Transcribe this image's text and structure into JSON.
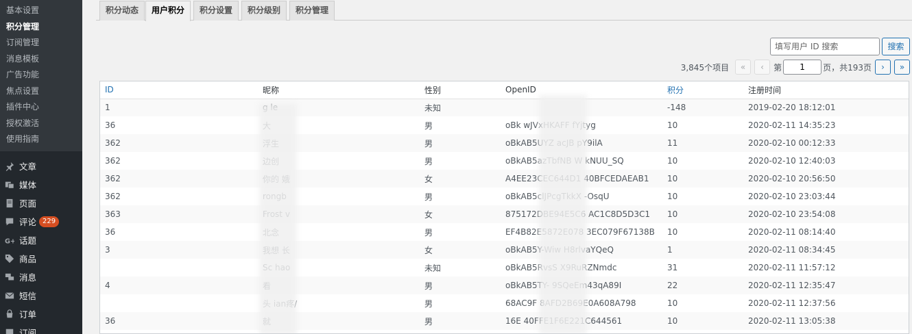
{
  "sidebar": {
    "submenu": [
      {
        "label": "基本设置",
        "current": false
      },
      {
        "label": "积分管理",
        "current": true
      },
      {
        "label": "订阅管理",
        "current": false
      },
      {
        "label": "消息模板",
        "current": false
      },
      {
        "label": "广告功能",
        "current": false
      },
      {
        "label": "焦点设置",
        "current": false
      },
      {
        "label": "插件中心",
        "current": false
      },
      {
        "label": "授权激活",
        "current": false
      },
      {
        "label": "使用指南",
        "current": false
      }
    ],
    "menu": [
      {
        "label": "文章",
        "icon": "pin-icon"
      },
      {
        "label": "媒体",
        "icon": "media-icon"
      },
      {
        "label": "页面",
        "icon": "page-icon"
      },
      {
        "label": "评论",
        "icon": "comment-icon",
        "badge": "229"
      },
      {
        "label": "话题",
        "icon": "google-plus-icon"
      },
      {
        "label": "商品",
        "icon": "tag-icon"
      },
      {
        "label": "消息",
        "icon": "messages-icon"
      },
      {
        "label": "短信",
        "icon": "mail-icon"
      },
      {
        "label": "订单",
        "icon": "cart-icon"
      },
      {
        "label": "订阅",
        "icon": "list-icon"
      }
    ]
  },
  "tabs": [
    {
      "label": "积分动态",
      "active": false
    },
    {
      "label": "用户积分",
      "active": true
    },
    {
      "label": "积分设置",
      "active": false
    },
    {
      "label": "积分级别",
      "active": false
    },
    {
      "label": "积分管理",
      "active": false
    }
  ],
  "search": {
    "placeholder": "填写用户 ID 搜索",
    "button": "搜索"
  },
  "pagination": {
    "total_items": "3,845个项目",
    "first": "«",
    "prev": "‹",
    "next": "›",
    "last": "»",
    "page_prefix": "第",
    "current_page": "1",
    "page_suffix": "页，共193页"
  },
  "table": {
    "headers": {
      "id": "ID",
      "nickname": "昵称",
      "gender": "性别",
      "openid": "OpenID",
      "points": "积分",
      "registered": "注册时间"
    },
    "rows": [
      {
        "id": "1",
        "nickname": "g      le",
        "gender": "未知",
        "openid": "",
        "points": "-148",
        "registered": "2019-02-20 18:12:01"
      },
      {
        "id": "36",
        "nickname": "大",
        "gender": "男",
        "openid": "oBk        wJVxHKAFF     fYjtyg",
        "points": "10",
        "registered": "2020-02-11 14:35:23"
      },
      {
        "id": "362",
        "nickname": "浮生",
        "gender": "男",
        "openid": "oBkAB5UYZ       acJB      pY9ilA",
        "points": "11",
        "registered": "2020-02-10 00:12:33"
      },
      {
        "id": "362",
        "nickname": "边创",
        "gender": "男",
        "openid": "oBkAB5azTbfNB      W      kNUU_SQ",
        "points": "10",
        "registered": "2020-02-10 12:40:03"
      },
      {
        "id": "362",
        "nickname": "你的          娥",
        "gender": "女",
        "openid": "A4EE23CEC644D1        40BFCEDAEAB1",
        "points": "10",
        "registered": "2020-02-10 20:56:50"
      },
      {
        "id": "362",
        "nickname": "rongb",
        "gender": "男",
        "openid": "oBkAB5clJPcgTkkX        -OsqU",
        "points": "10",
        "registered": "2020-02-10 23:03:44"
      },
      {
        "id": "363",
        "nickname": "Frost        v",
        "gender": "女",
        "openid": "875172DBE94E5C6      AC1C8D5D3C1",
        "points": "10",
        "registered": "2020-02-10 23:54:08"
      },
      {
        "id": "36",
        "nickname": "北念",
        "gender": "男",
        "openid": "EF4B82E5872E078       3EC079F67138B",
        "points": "10",
        "registered": "2020-02-11 08:14:40"
      },
      {
        "id": "3",
        "nickname": "我想          长",
        "gender": "女",
        "openid": "oBkAB5Y-Wiw          H8rlvaYQeQ",
        "points": "1",
        "registered": "2020-02-11 08:34:45"
      },
      {
        "id": "",
        "nickname": "Sc        hao",
        "gender": "未知",
        "openid": "oBkAB5RvsS          X9RuRZNmdc",
        "points": "31",
        "registered": "2020-02-11 11:57:12"
      },
      {
        "id": "4",
        "nickname": "看",
        "gender": "男",
        "openid": "oBkAB5TY-         9SQeEm43qA89I",
        "points": "22",
        "registered": "2020-02-11 12:35:47"
      },
      {
        "id": "",
        "nickname": "头      ian疼/",
        "gender": "男",
        "openid": "68AC9F         8AFD2B69E0A608A798",
        "points": "10",
        "registered": "2020-02-11 12:37:56"
      },
      {
        "id": "36",
        "nickname": "就",
        "gender": "男",
        "openid": "16E         40FFE1F6E221C644561",
        "points": "10",
        "registered": "2020-02-11 13:05:38"
      }
    ]
  }
}
